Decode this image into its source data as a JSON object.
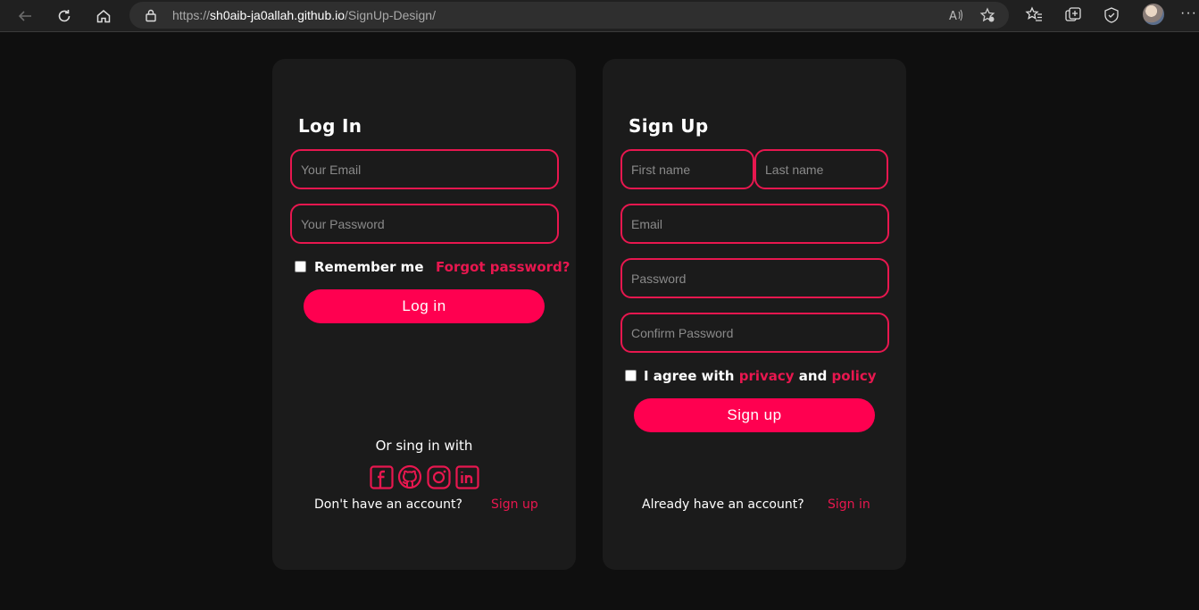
{
  "browser": {
    "url_prefix": "https://",
    "url_host": "sh0aib-ja0allah.github.io",
    "url_path": "/SignUp-Design/",
    "more_label": "···"
  },
  "login": {
    "title": "Log In",
    "email_placeholder": "Your Email",
    "password_placeholder": "Your Password",
    "remember_label": "Remember me",
    "forgot_label": "Forgot password?",
    "login_button": "Log in",
    "or_sign_in": "Or sing in with",
    "social_icons": [
      "facebook-icon",
      "github-icon",
      "instagram-icon",
      "linkedin-icon"
    ],
    "no_account": "Don't have an account?",
    "signup_link": "Sign up"
  },
  "signup": {
    "title": "Sign Up",
    "first_name_placeholder": "First name",
    "last_name_placeholder": "Last name",
    "email_placeholder": "Email",
    "password_placeholder": "Password",
    "confirm_placeholder": "Confirm Password",
    "agree_prefix": "I agree with ",
    "privacy_label": "privacy",
    "and_label": " and ",
    "policy_label": "policy",
    "signup_button": "Sign up",
    "have_account": "Already have an account?",
    "signin_link": "Sign in"
  },
  "colors": {
    "accent": "#e8174f",
    "button": "#ff0050",
    "card": "#1b1b1b",
    "page": "#0f0f0f"
  }
}
